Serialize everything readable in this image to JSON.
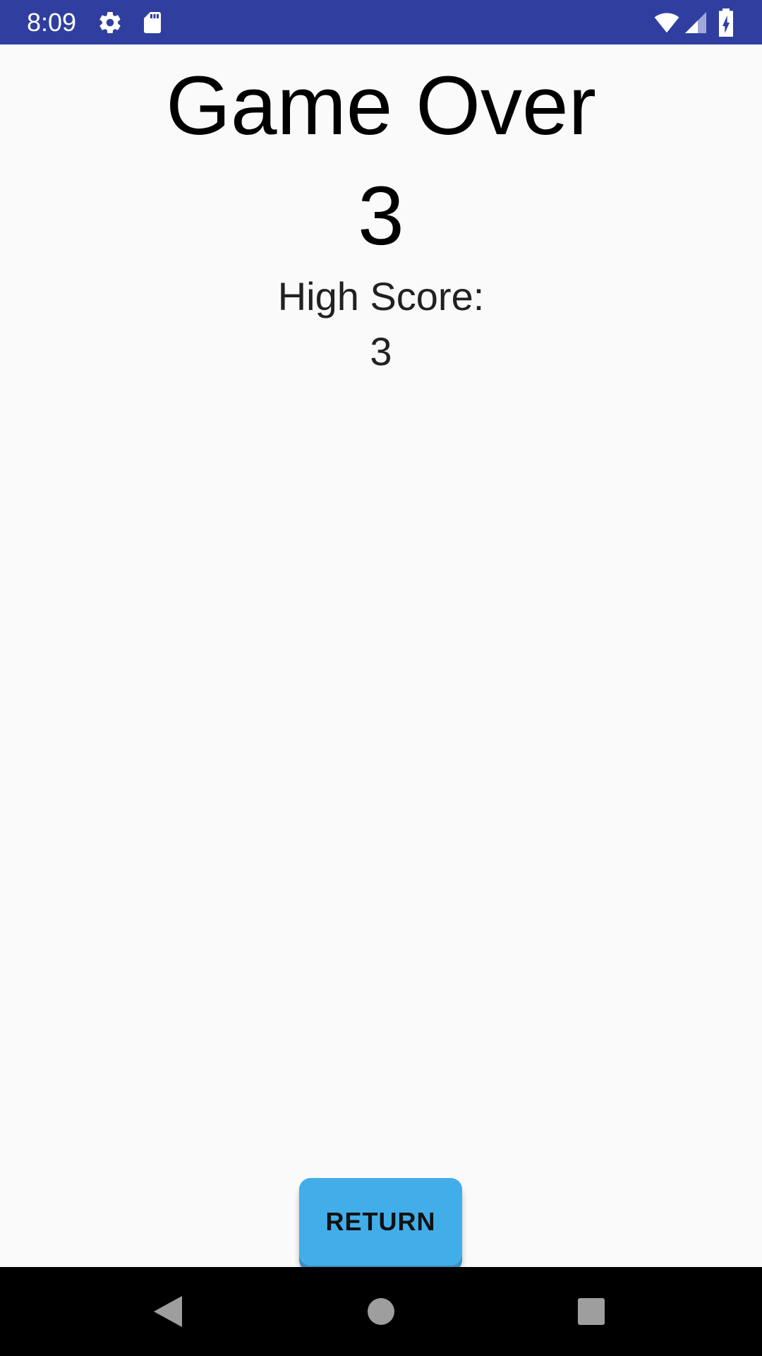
{
  "status_bar": {
    "time": "8:09",
    "icons": [
      "gear-icon",
      "sd-card-icon",
      "wifi-icon",
      "cell-signal-icon",
      "battery-charging-icon"
    ],
    "color": "#303f9f"
  },
  "game_over": {
    "title": "Game Over",
    "score": "3",
    "high_score_label": "High Score:",
    "high_score_value": "3"
  },
  "actions": {
    "return_label": "RETURN",
    "button_color": "#41aeea"
  },
  "nav_bar": {
    "icons": [
      "back-icon",
      "home-icon",
      "recents-icon"
    ]
  }
}
